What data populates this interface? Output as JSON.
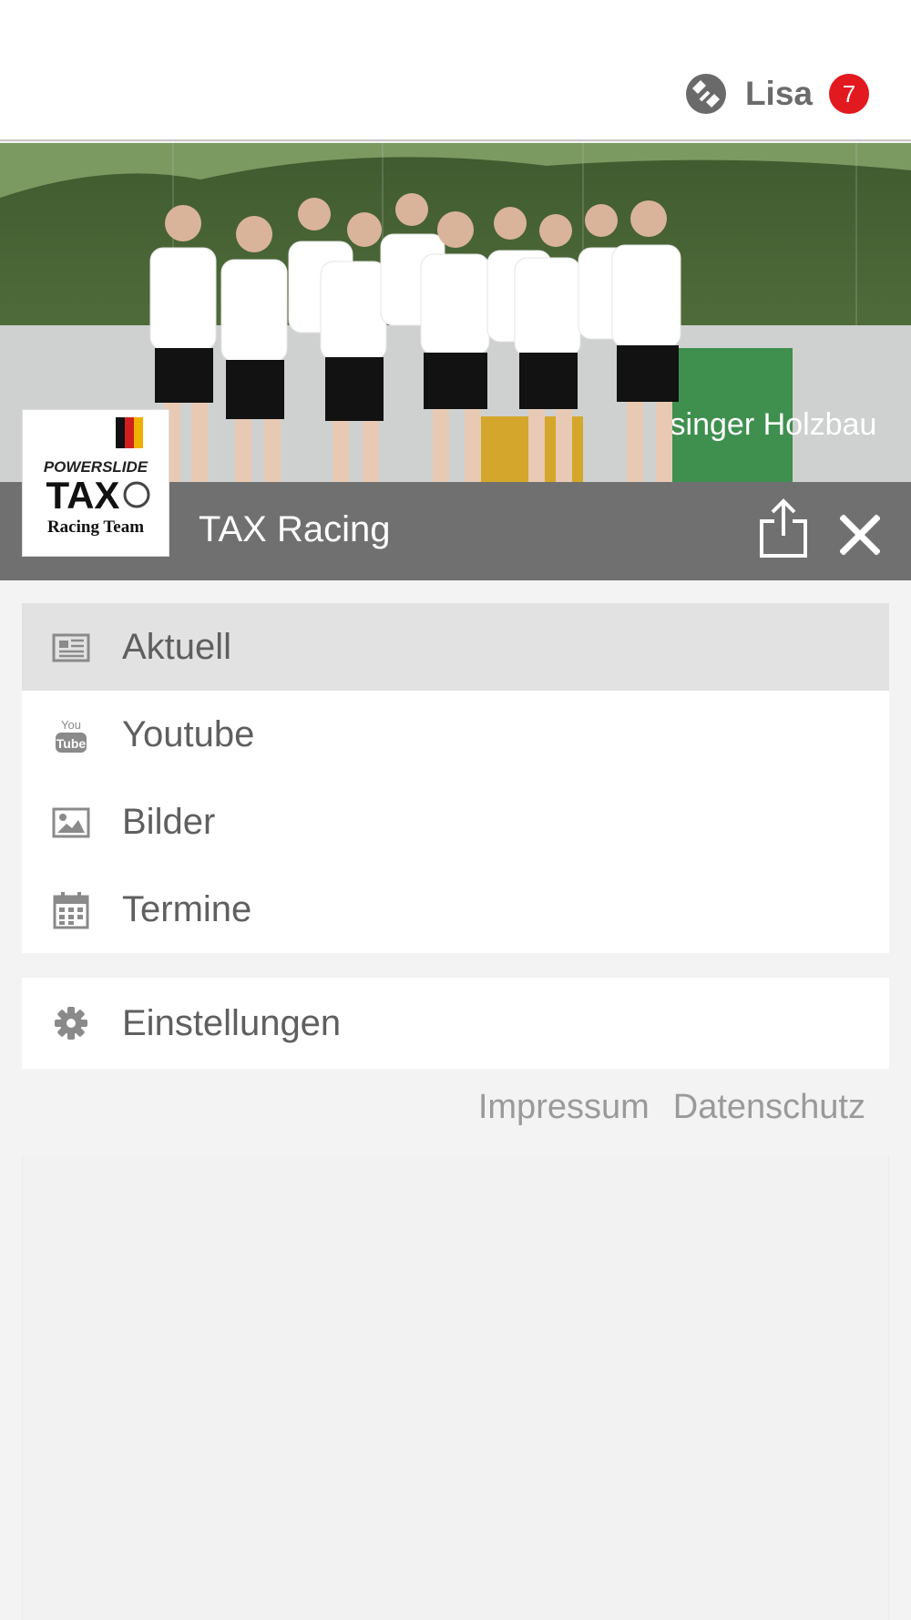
{
  "header": {
    "user_name": "Lisa",
    "notification_count": "7"
  },
  "club": {
    "name": "TAX Racing",
    "logo_text": [
      "POWERSLIDE",
      "TAX",
      "Racing Team"
    ],
    "banner_text": "isinger Holzbau"
  },
  "menu": {
    "items": [
      {
        "label": "Aktuell",
        "icon": "newspaper-icon",
        "active": true
      },
      {
        "label": "Youtube",
        "icon": "youtube-icon",
        "active": false
      },
      {
        "label": "Bilder",
        "icon": "image-icon",
        "active": false
      },
      {
        "label": "Termine",
        "icon": "calendar-icon",
        "active": false
      }
    ]
  },
  "settings": {
    "label": "Einstellungen",
    "icon": "gear-icon"
  },
  "footer": {
    "impressum": "Impressum",
    "datenschutz": "Datenschutz"
  },
  "colors": {
    "badge": "#e2191e",
    "club_bar": "#707070",
    "active_item": "#e2e2e2",
    "text": "#5f5f5f",
    "link": "#9a9a9a"
  }
}
